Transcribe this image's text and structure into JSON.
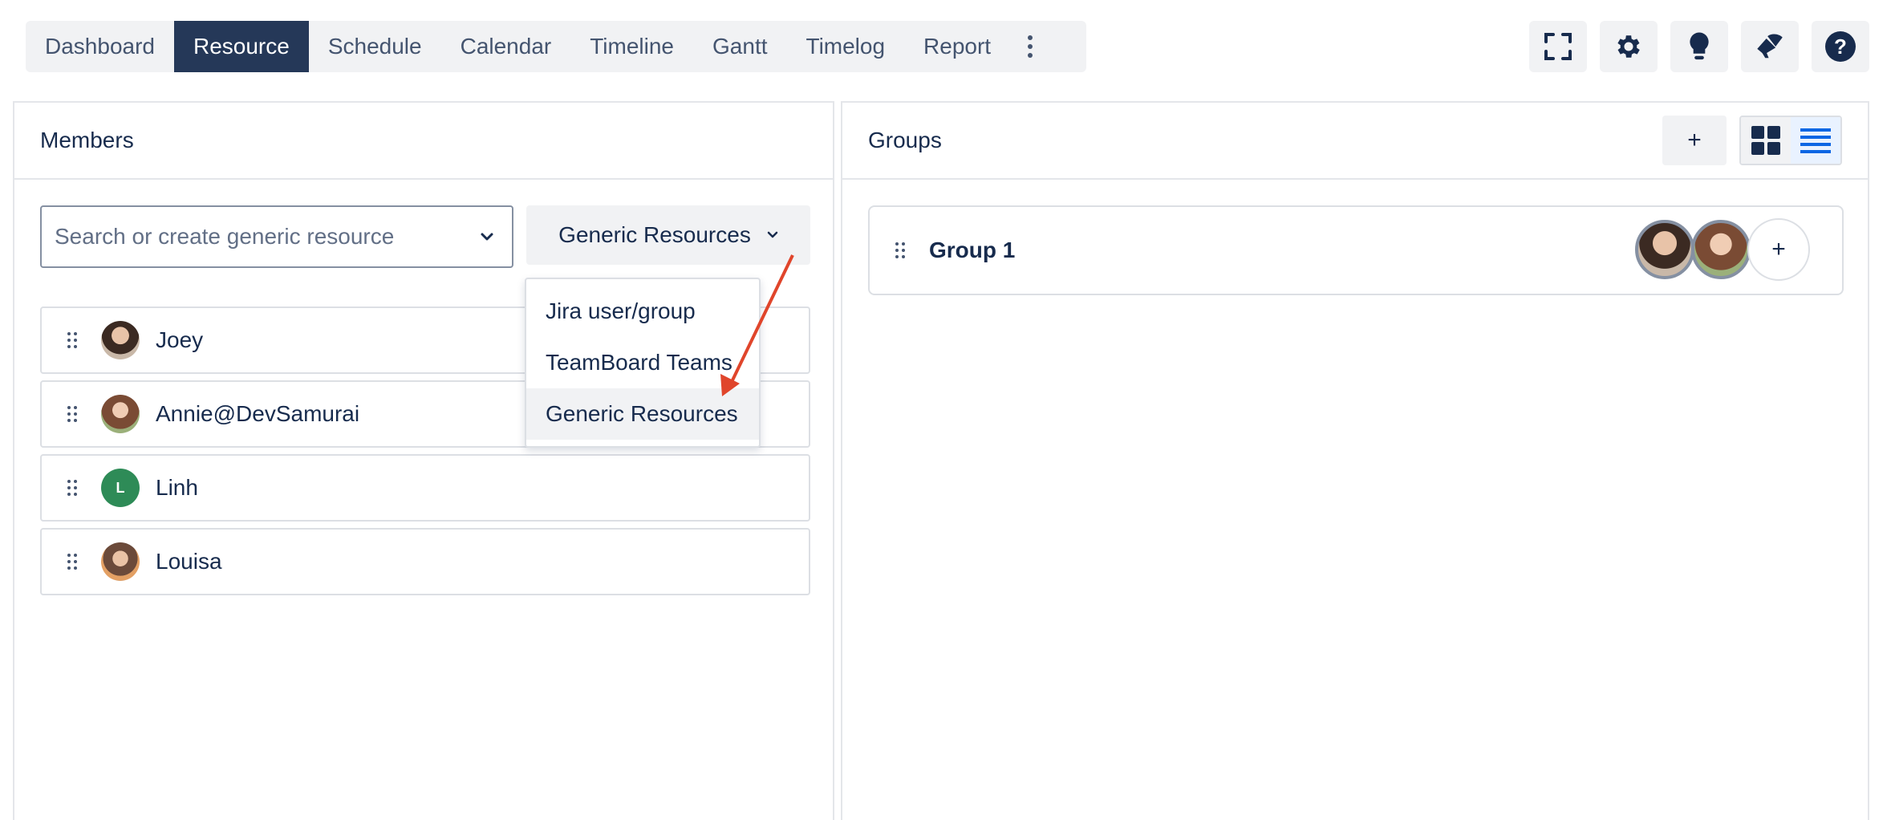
{
  "nav": {
    "tabs": [
      {
        "label": "Dashboard",
        "active": false
      },
      {
        "label": "Resource",
        "active": true
      },
      {
        "label": "Schedule",
        "active": false
      },
      {
        "label": "Calendar",
        "active": false
      },
      {
        "label": "Timeline",
        "active": false
      },
      {
        "label": "Gantt",
        "active": false
      },
      {
        "label": "Timelog",
        "active": false
      },
      {
        "label": "Report",
        "active": false
      }
    ],
    "more_icon": "vertical-dots-icon"
  },
  "toolbar": {
    "icons": [
      "fullscreen-icon",
      "gear-icon",
      "lightbulb-icon",
      "megaphone-icon",
      "help-icon"
    ]
  },
  "members": {
    "title": "Members",
    "search": {
      "placeholder": "Search or create generic resource",
      "value": ""
    },
    "type_select": {
      "value": "Generic Resources"
    },
    "dropdown_options": [
      {
        "label": "Jira user/group",
        "selected": false
      },
      {
        "label": "TeamBoard Teams",
        "selected": false
      },
      {
        "label": "Generic Resources",
        "selected": true
      }
    ],
    "list": [
      {
        "name": "Joey",
        "avatar": "photo"
      },
      {
        "name": "Annie@DevSamurai",
        "avatar": "photo"
      },
      {
        "name": "Linh",
        "avatar": "letter",
        "initial": "L"
      },
      {
        "name": "Louisa",
        "avatar": "photo"
      }
    ]
  },
  "groups": {
    "title": "Groups",
    "add_label": "+",
    "view_modes": [
      "grid-view-icon",
      "list-view-icon"
    ],
    "active_view": "list-view-icon",
    "items": [
      {
        "name": "Group 1",
        "member_count": 2,
        "add_label": "+"
      }
    ]
  },
  "colors": {
    "active_tab": "#253858",
    "text": "#172b4d",
    "muted": "#44546f",
    "surface": "#f1f2f4",
    "border": "#dcdfe4",
    "linh_avatar": "#2e8b57",
    "annotation_arrow": "#e0452b",
    "list_view_active": "#0c66e4"
  }
}
